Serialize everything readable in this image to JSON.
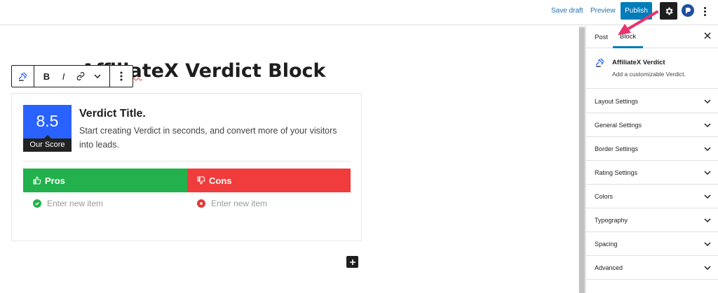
{
  "topbar": {
    "save_draft": "Save draft",
    "preview": "Preview",
    "publish": "Publish"
  },
  "editor": {
    "doc_title_prefix": "Affilia",
    "doc_title_suffix": "teX Verdict Block",
    "toolbar": {
      "bold": "B",
      "italic": "I"
    }
  },
  "verdict": {
    "score": "8.5",
    "score_label": "Our Score",
    "title": "Verdict Title.",
    "description": "Start creating Verdict in seconds, and convert more of your visitors into leads.",
    "pros_label": "Pros",
    "cons_label": "Cons",
    "pros_placeholder": "Enter new item",
    "cons_placeholder": "Enter new item",
    "colors": {
      "score_bg": "#2962ff",
      "pros": "#22b14c",
      "cons": "#f03c3c"
    }
  },
  "sidebar": {
    "tabs": {
      "post": "Post",
      "block": "Block"
    },
    "block_name": "AffiliateX Verdict",
    "block_desc": "Add a customizable Verdict.",
    "panels": [
      "Layout Settings",
      "General Settings",
      "Border Settings",
      "Rating Settings",
      "Colors",
      "Typography",
      "Spacing",
      "Advanced"
    ]
  },
  "annotation": {
    "arrow_color": "#e8336e"
  }
}
